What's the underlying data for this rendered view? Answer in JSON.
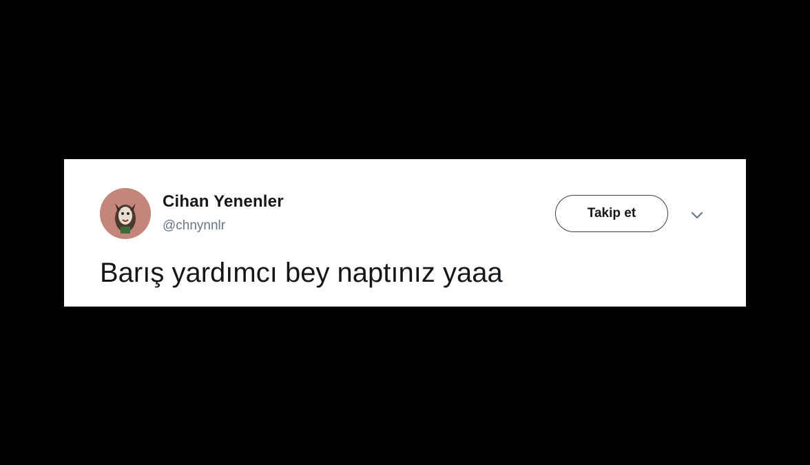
{
  "tweet": {
    "author": {
      "display_name": "Cihan Yenenler",
      "handle": "@chnynnlr",
      "avatar_icon": "profile-avatar"
    },
    "follow_label": "Takip et",
    "menu_icon": "chevron-down-icon",
    "text": "Barış yardımcı bey naptınız yaaa"
  },
  "colors": {
    "page_background": "#000000",
    "card_background": "#ffffff",
    "text_primary": "#14171a",
    "text_secondary": "#657786",
    "avatar_background": "#c4867a"
  }
}
